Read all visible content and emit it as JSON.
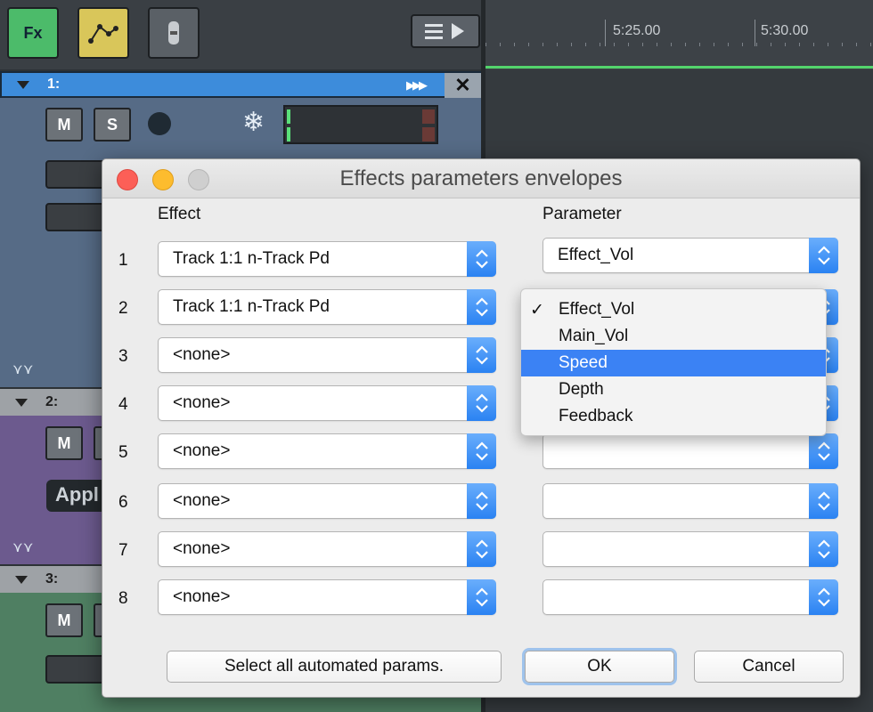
{
  "daw": {
    "toolbar": {
      "fx_label": "Fx"
    },
    "ruler": {
      "time_labels": [
        "5:25.00",
        "5:30.00"
      ]
    },
    "tracks": [
      {
        "number": "1:",
        "mute": "M",
        "solo": "S"
      },
      {
        "number": "2:",
        "mute": "M",
        "clip_text": "Appl"
      },
      {
        "number": "3:",
        "mute": "M"
      }
    ]
  },
  "dialog": {
    "title": "Effects parameters envelopes",
    "columns": {
      "effect": "Effect",
      "parameter": "Parameter"
    },
    "rows": [
      {
        "index": "1",
        "effect": "Track 1:1 n-Track Pd",
        "parameter": "Effect_Vol"
      },
      {
        "index": "2",
        "effect": "Track 1:1 n-Track Pd",
        "parameter": ""
      },
      {
        "index": "3",
        "effect": "<none>",
        "parameter": ""
      },
      {
        "index": "4",
        "effect": "<none>",
        "parameter": ""
      },
      {
        "index": "5",
        "effect": "<none>",
        "parameter": ""
      },
      {
        "index": "6",
        "effect": "<none>",
        "parameter": ""
      },
      {
        "index": "7",
        "effect": "<none>",
        "parameter": ""
      },
      {
        "index": "8",
        "effect": "<none>",
        "parameter": ""
      }
    ],
    "buttons": {
      "select_all": "Select all automated params.",
      "ok": "OK",
      "cancel": "Cancel"
    },
    "dropdown": {
      "check_mark": "✓",
      "options": [
        "Effect_Vol",
        "Main_Vol",
        "Speed",
        "Depth",
        "Feedback"
      ],
      "checked": "Effect_Vol",
      "highlighted": "Speed"
    }
  },
  "colors": {
    "accent": "#3b82f4",
    "fx_button": "#4cbb6a",
    "track1_header": "#3d8cdb",
    "track2": "#6c5a8e",
    "track3": "#4f7f62"
  },
  "icons": [
    "menu-icon",
    "play-arrow-icon",
    "envelope-icon",
    "snowflake-icon",
    "fast-forward-icon",
    "close-icon",
    "chevron-updown-icon",
    "checkmark-icon"
  ]
}
